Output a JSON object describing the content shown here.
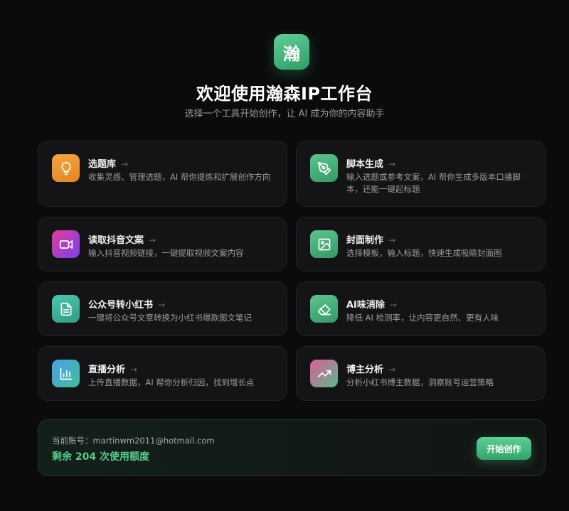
{
  "header": {
    "logo_char": "瀚",
    "title": "欢迎使用瀚森IP工作台",
    "subtitle": "选择一个工具开始创作，让 AI 成为你的内容助手"
  },
  "arrow_glyph": "→",
  "tools": [
    {
      "title": "选题库",
      "desc": "收集灵感、管理选题，AI 帮你提炼和扩展创作方向",
      "icon": "lightbulb-icon",
      "color": "#f0962f"
    },
    {
      "title": "脚本生成",
      "desc": "输入选题或参考文案，AI 帮你生成多版本口播脚本，还能一键起标题",
      "icon": "pen-nib-icon",
      "color": "#47b07b"
    },
    {
      "title": "读取抖音文案",
      "desc": "输入抖音视频链接，一键提取视频文案内容",
      "icon": "video-camera-icon",
      "color": "#b13ec4"
    },
    {
      "title": "封面制作",
      "desc": "选择模板，输入标题，快速生成吸睛封面图",
      "icon": "image-icon",
      "color": "#3fae82"
    },
    {
      "title": "公众号转小红书",
      "desc": "一键将公众号文章转换为小红书爆款图文笔记",
      "icon": "document-icon",
      "color": "#3fb39a"
    },
    {
      "title": "AI味消除",
      "desc": "降低 AI 检测率，让内容更自然、更有人味",
      "icon": "eraser-icon",
      "color": "#47b07b"
    },
    {
      "title": "直播分析",
      "desc": "上传直播数据，AI 帮你分析归因，找到增长点",
      "icon": "bar-chart-icon",
      "color": "#45aec0"
    },
    {
      "title": "博主分析",
      "desc": "分析小红书博主数据，洞察账号运营策略",
      "icon": "trending-up-icon",
      "color": "#b47c98"
    }
  ],
  "footer": {
    "account_label": "当前账号：",
    "account_email": "martinwm2011@hotmail.com",
    "quota_prefix": "剩余",
    "quota_count": "204",
    "quota_suffix": "次使用额度",
    "start_button": "开始创作"
  }
}
